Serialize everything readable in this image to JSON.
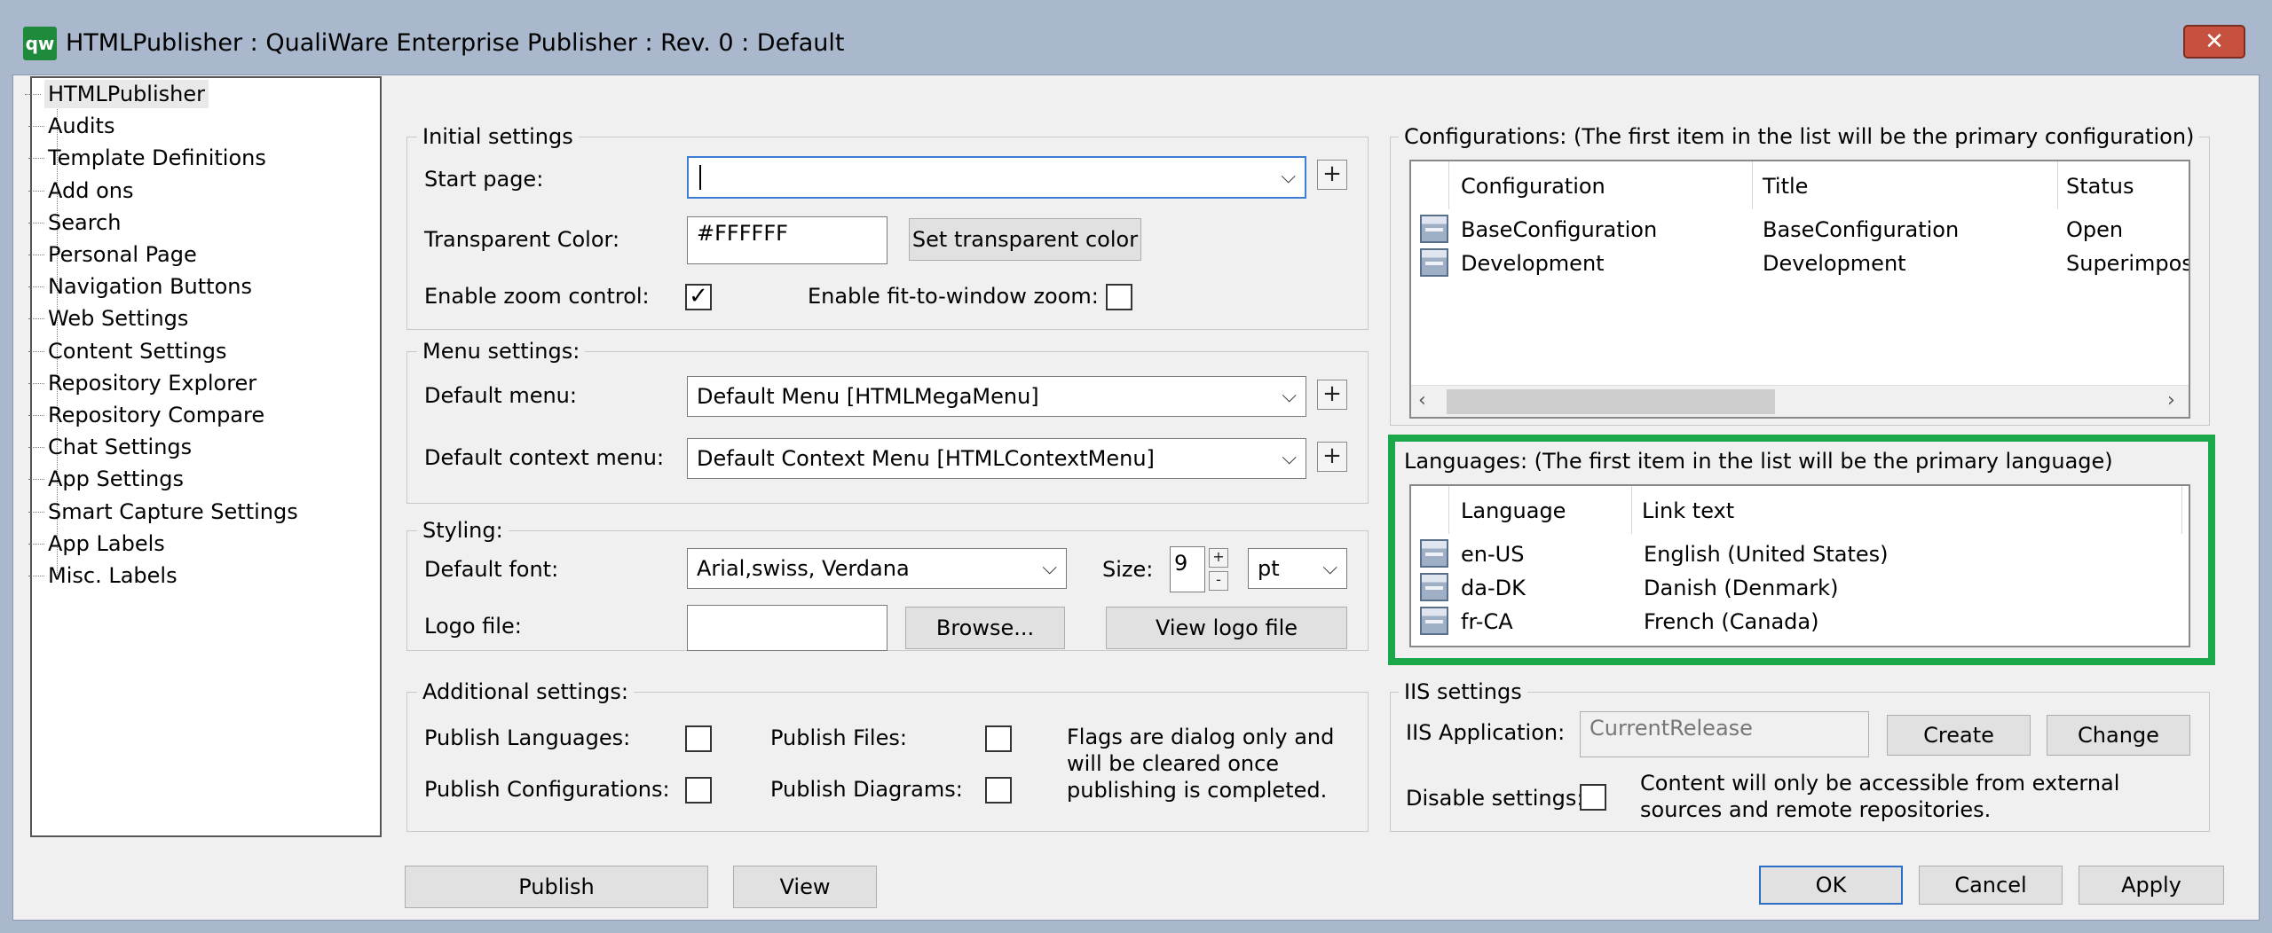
{
  "window": {
    "app_icon_text": "qw",
    "title": "HTMLPublisher : QualiWare Enterprise Publisher : Rev. 0  : Default",
    "close_symbol": "✕"
  },
  "tree": {
    "items": [
      "HTMLPublisher",
      "Audits",
      "Template Definitions",
      "Add ons",
      "Search",
      "Personal Page",
      "Navigation Buttons",
      "Web Settings",
      "Content Settings",
      "Repository Explorer",
      "Repository Compare",
      "Chat Settings",
      "App Settings",
      "Smart Capture Settings",
      "App Labels",
      "Misc. Labels"
    ]
  },
  "initial": {
    "title": "Initial settings",
    "start_page_label": "Start page:",
    "start_page_value": "",
    "transparent_label": "Transparent Color:",
    "transparent_value": "#FFFFFF",
    "set_color_button": "Set transparent color",
    "zoom_label": "Enable zoom control:",
    "zoom_checked": "✓",
    "fit_label": "Enable fit-to-window zoom:",
    "fit_checked": ""
  },
  "menu": {
    "title": "Menu settings:",
    "default_label": "Default menu:",
    "default_value": "Default Menu [HTMLMegaMenu]",
    "context_label": "Default context menu:",
    "context_value": "Default Context Menu [HTMLContextMenu]"
  },
  "styling": {
    "title": "Styling:",
    "font_label": "Default font:",
    "font_value": "Arial,swiss, Verdana",
    "size_label": "Size:",
    "size_value": "9",
    "unit_value": "pt",
    "logo_label": "Logo file:",
    "browse_button": "Browse...",
    "view_logo_button": "View logo file"
  },
  "additional": {
    "title": "Additional settings:",
    "publish_languages": "Publish Languages:",
    "publish_configurations": "Publish Configurations:",
    "publish_files": "Publish Files:",
    "publish_diagrams": "Publish Diagrams:",
    "note": "Flags are dialog only and will be cleared once publishing is completed."
  },
  "configurations": {
    "title": "Configurations: (The first item in the list will be the primary configuration)",
    "columns": [
      "Configuration",
      "Title",
      "Status"
    ],
    "rows": [
      {
        "configuration": "BaseConfiguration",
        "title": "BaseConfiguration",
        "status": "Open"
      },
      {
        "configuration": "Development",
        "title": "Development",
        "status": "Superimposed"
      }
    ]
  },
  "languages": {
    "title": "Languages: (The first item in the list will be the primary language)",
    "columns": [
      "Language",
      "Link text"
    ],
    "rows": [
      {
        "language": "en-US",
        "link_text": "English (United States)"
      },
      {
        "language": "da-DK",
        "link_text": "Danish (Denmark)"
      },
      {
        "language": "fr-CA",
        "link_text": "French (Canada)"
      }
    ]
  },
  "iis": {
    "title": "IIS settings",
    "app_label": "IIS Application:",
    "app_value": "CurrentRelease",
    "create_button": "Create",
    "change_button": "Change",
    "disable_label": "Disable settings:",
    "disable_note": "Content will only be accessible from external sources and remote repositories."
  },
  "footer": {
    "publish_button": "Publish",
    "view_button": "View",
    "ok_button": "OK",
    "cancel_button": "Cancel",
    "apply_button": "Apply"
  },
  "colors": {
    "highlight": "#1aa84a",
    "focus_border": "#3c7fd4"
  }
}
